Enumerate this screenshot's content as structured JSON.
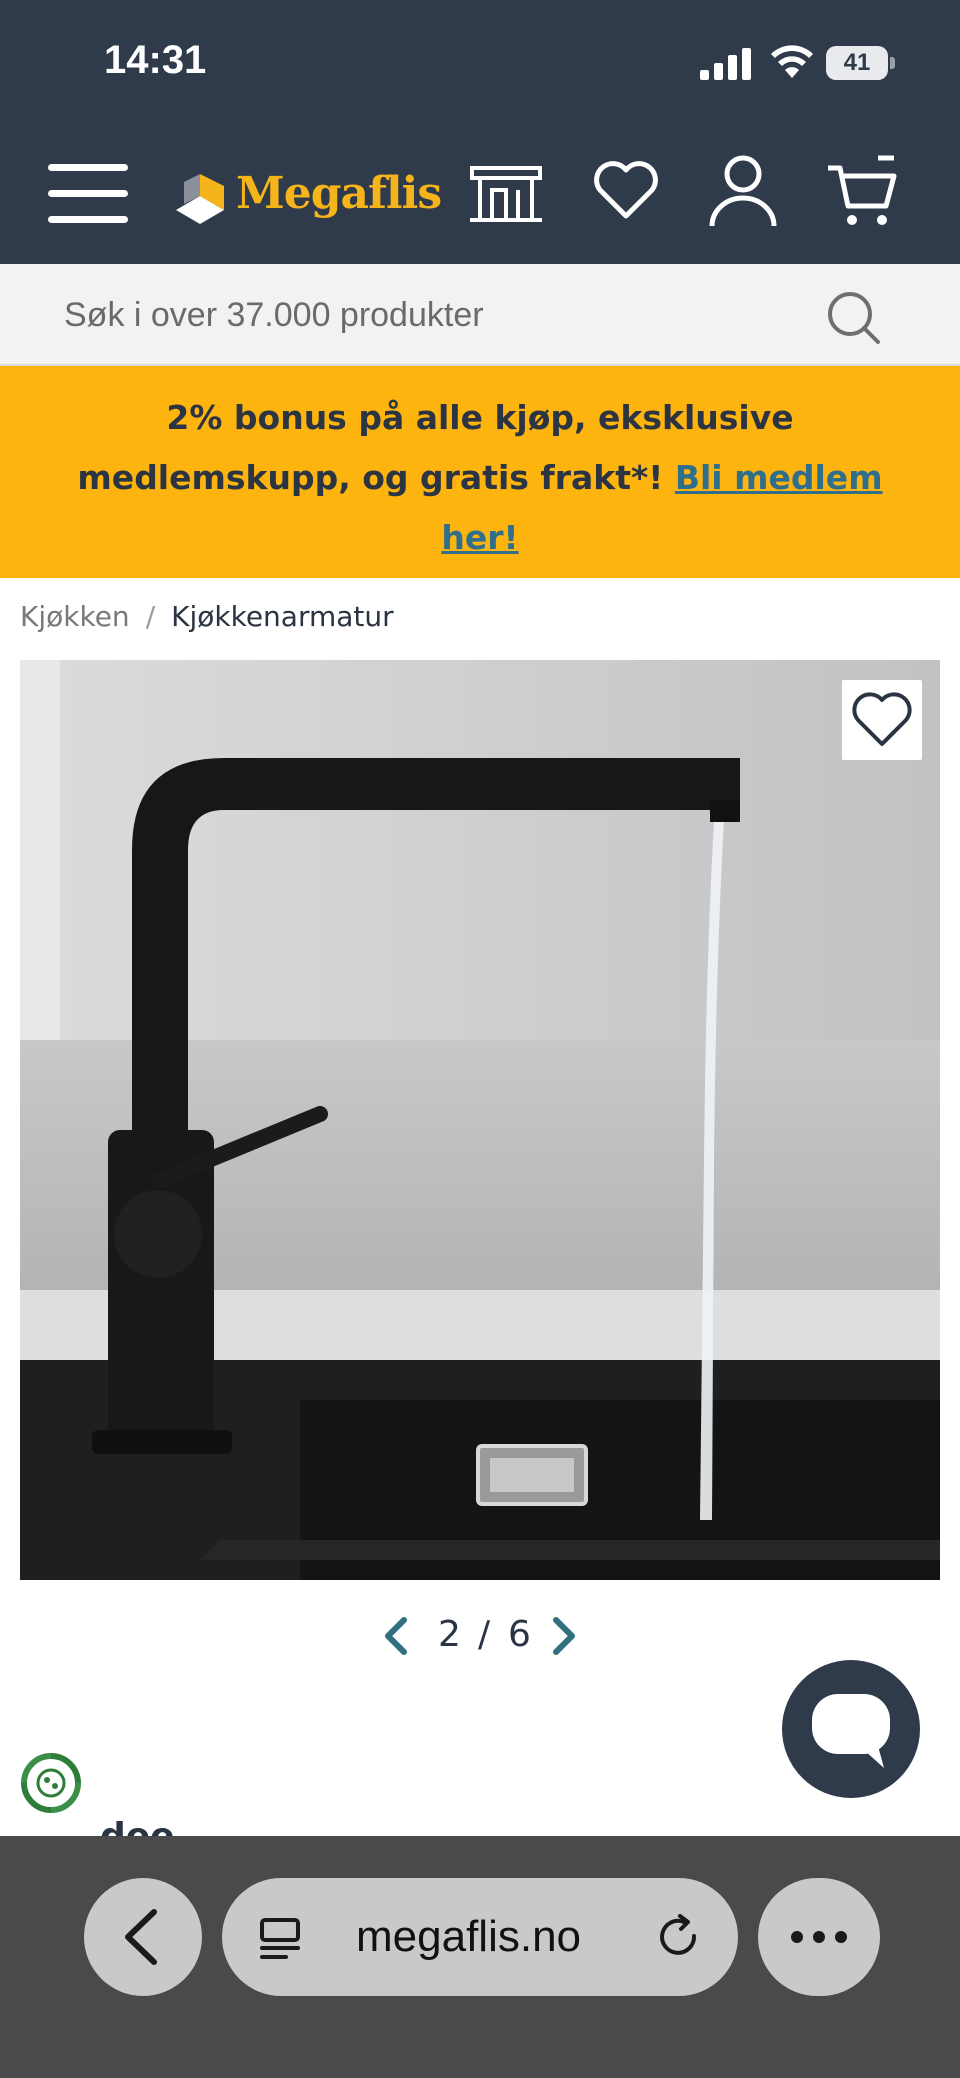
{
  "status_bar": {
    "time": "14:31",
    "battery": "41"
  },
  "header": {
    "logo_text": "Megaflis",
    "icons": [
      "menu-icon",
      "store-icon",
      "heart-icon",
      "user-icon",
      "cart-icon"
    ]
  },
  "search": {
    "placeholder": "Søk i over 37.000 produkter"
  },
  "promo": {
    "text": "2% bonus på alle kjøp, eksklusive medlemskupp, og gratis frakt",
    "asterisk": "*",
    "exclaim": "! ",
    "link_text": "Bli medlem her!"
  },
  "breadcrumb": {
    "items": [
      "Kjøkken",
      "Kjøkkenarmatur"
    ],
    "separator": "/"
  },
  "gallery": {
    "current": "2",
    "separator": "/",
    "total": "6"
  },
  "partial_text": "dee",
  "browser": {
    "url": "megaflis.no"
  },
  "colors": {
    "header_bg": "#2f3a4a",
    "brand_yellow": "#f4b41a",
    "promo_bg": "#fdb40e",
    "link": "#2f6f8c",
    "accent_teal": "#2f6f7e"
  }
}
